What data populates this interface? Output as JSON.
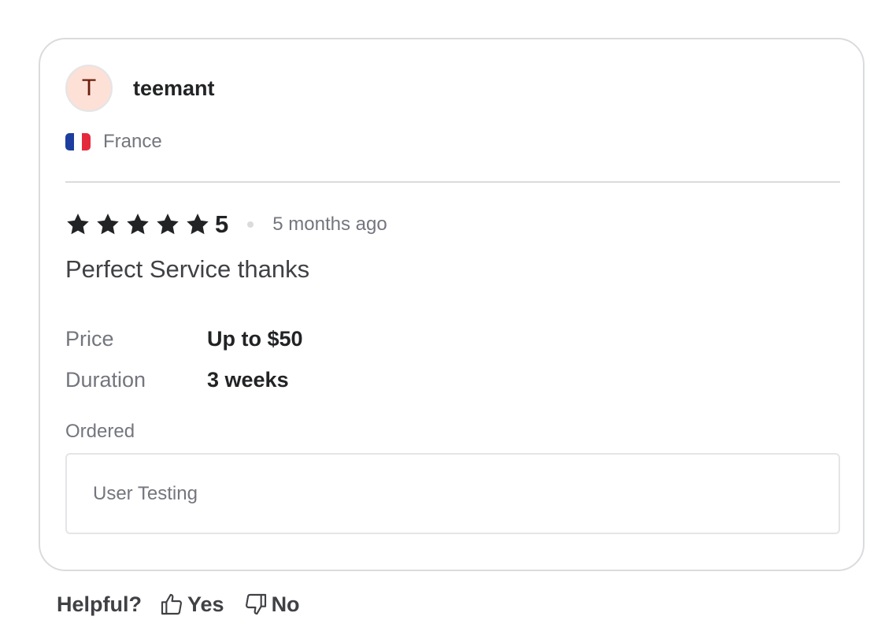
{
  "reviewer": {
    "initial": "T",
    "username": "teemant",
    "country": "France",
    "avatar_color": "#fde0d6"
  },
  "review": {
    "rating": 5,
    "rating_label": "5",
    "time_ago": "5 months ago",
    "text": "Perfect Service thanks"
  },
  "details": [
    {
      "label": "Price",
      "value": "Up to $50"
    },
    {
      "label": "Duration",
      "value": "3 weeks"
    }
  ],
  "ordered": {
    "label": "Ordered",
    "item": "User Testing"
  },
  "helpful": {
    "label": "Helpful?",
    "yes": "Yes",
    "no": "No"
  },
  "icons": {
    "star": "star-icon",
    "thumbs_up": "thumbs-up-icon",
    "thumbs_down": "thumbs-down-icon",
    "flag": "france-flag-icon"
  }
}
